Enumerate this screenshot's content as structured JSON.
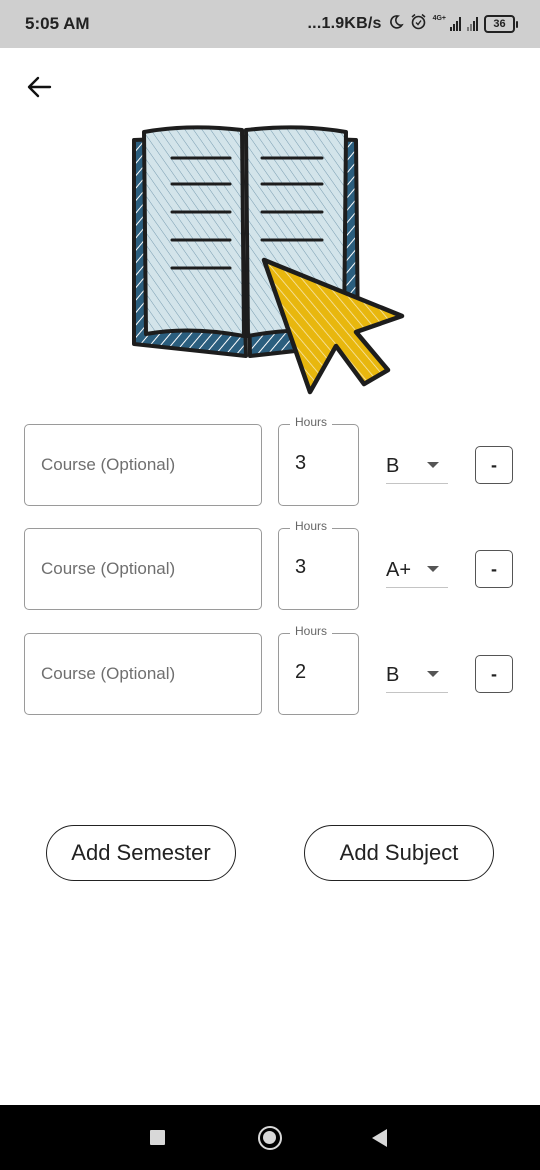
{
  "status_bar": {
    "time": "5:05 AM",
    "network_speed": "...1.9KB/s",
    "network_type": "4G+",
    "battery": "36",
    "icons": [
      "moon-icon",
      "alarm-icon",
      "signal-icon",
      "signal-icon",
      "battery-icon"
    ]
  },
  "header": {
    "back_icon": "arrow-left-icon"
  },
  "illustration": {
    "name": "book-with-cursor-illustration"
  },
  "courses": {
    "placeholder": "Course (Optional)",
    "hours_label": "Hours",
    "remove_label": "-",
    "rows": [
      {
        "course": "",
        "hours": "3",
        "grade": "B"
      },
      {
        "course": "",
        "hours": "3",
        "grade": "A+"
      },
      {
        "course": "",
        "hours": "2",
        "grade": "B"
      }
    ]
  },
  "actions": {
    "add_semester": "Add Semester",
    "add_subject": "Add Subject"
  },
  "colors": {
    "status_bar_bg": "#cfcfcf",
    "nav_bar_bg": "#000000",
    "book_cover": "#2b5e7e",
    "book_pages": "#d3e4ea",
    "cursor": "#e8b70e"
  }
}
